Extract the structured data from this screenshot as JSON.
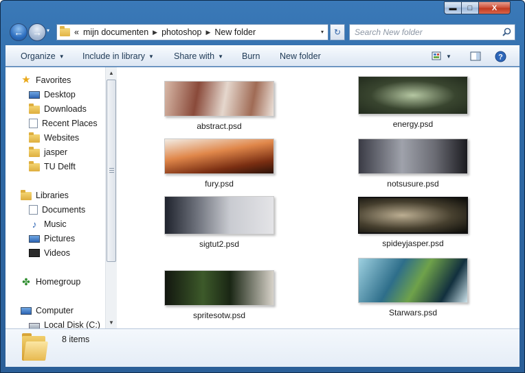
{
  "window": {
    "minimize_glyph": "▬",
    "maximize_glyph": "□",
    "close_glyph": "X"
  },
  "navbar": {
    "back_glyph": "←",
    "forward_glyph": "→",
    "history_glyph": "▾",
    "address_prefix": "«",
    "breadcrumbs": [
      "mijn documenten",
      "photoshop",
      "New folder"
    ],
    "separator_glyph": "▶",
    "dropdown_glyph": "▾",
    "refresh_glyph": "↻",
    "search_placeholder": "Search New folder"
  },
  "toolbar": {
    "items": [
      {
        "label": "Organize",
        "has_menu": true
      },
      {
        "label": "Include in library",
        "has_menu": true
      },
      {
        "label": "Share with",
        "has_menu": true
      },
      {
        "label": "Burn",
        "has_menu": false
      },
      {
        "label": "New folder",
        "has_menu": false
      }
    ],
    "caret_glyph": "▼",
    "help_glyph": "?"
  },
  "nav_pane": {
    "favorites": {
      "label": "Favorites",
      "icon": "star-icon"
    },
    "favorite_items": [
      {
        "label": "Desktop",
        "icon": "desktop-icon"
      },
      {
        "label": "Downloads",
        "icon": "downloads-folder-icon"
      },
      {
        "label": "Recent Places",
        "icon": "recent-places-icon"
      },
      {
        "label": "Websites",
        "icon": "folder-icon"
      },
      {
        "label": "jasper",
        "icon": "folder-icon"
      },
      {
        "label": "TU Delft",
        "icon": "folder-icon"
      }
    ],
    "libraries": {
      "label": "Libraries",
      "icon": "libraries-icon"
    },
    "library_items": [
      {
        "label": "Documents",
        "icon": "documents-icon"
      },
      {
        "label": "Music",
        "icon": "music-icon"
      },
      {
        "label": "Pictures",
        "icon": "pictures-icon"
      },
      {
        "label": "Videos",
        "icon": "videos-icon"
      }
    ],
    "homegroup": {
      "label": "Homegroup",
      "icon": "homegroup-icon"
    },
    "computer": {
      "label": "Computer",
      "icon": "computer-icon"
    },
    "computer_items": [
      {
        "label": "Local Disk (C:)",
        "icon": "disk-icon"
      }
    ],
    "scroll_up_glyph": "▲",
    "scroll_down_glyph": "▼"
  },
  "files": [
    {
      "name": "abstract.psd"
    },
    {
      "name": "energy.psd"
    },
    {
      "name": "fury.psd"
    },
    {
      "name": "notsusure.psd"
    },
    {
      "name": "sigtut2.psd"
    },
    {
      "name": "spideyjasper.psd"
    },
    {
      "name": "spritesotw.psd"
    },
    {
      "name": "Starwars.psd"
    }
  ],
  "status": {
    "item_count": "8 items"
  },
  "colors": {
    "frame": "#2f6aa6",
    "close_button": "#c23a20",
    "toolbar_text": "#1e3955"
  }
}
